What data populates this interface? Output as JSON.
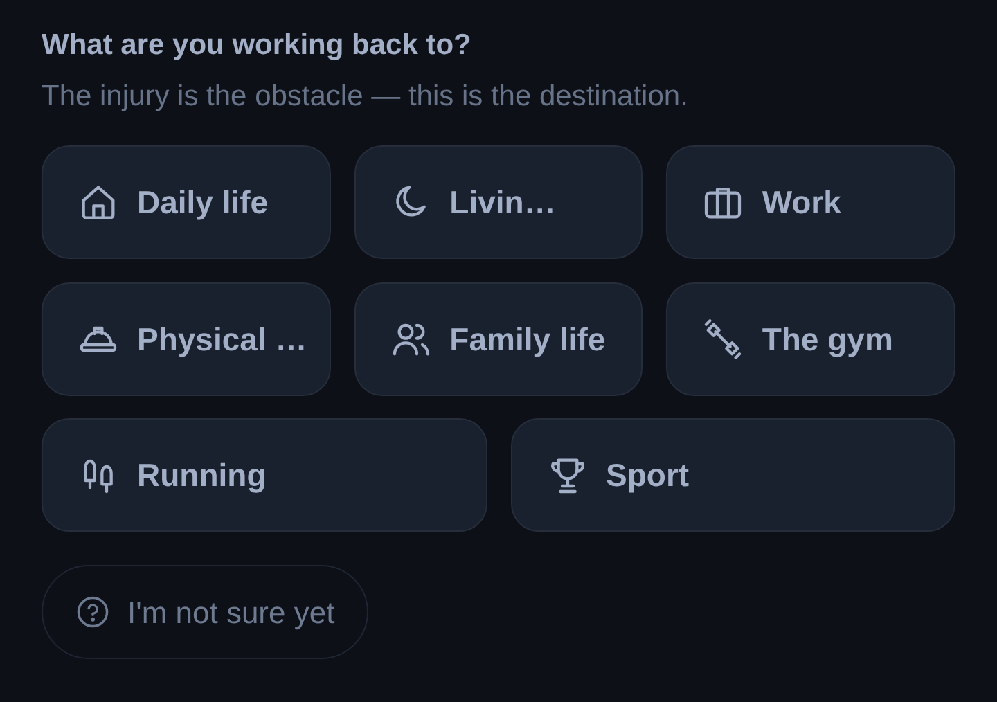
{
  "question": {
    "title": "What are you working back to?",
    "subtitle": "The injury is the obstacle — this is the destination."
  },
  "options": [
    {
      "label": "Daily life",
      "selected": false
    },
    {
      "label": "Livin…",
      "selected": false
    },
    {
      "label": "Work",
      "selected": false
    },
    {
      "label": "Physical …",
      "selected": false
    },
    {
      "label": "Family life",
      "selected": false
    },
    {
      "label": "The gym",
      "selected": false
    },
    {
      "label": "Running",
      "selected": false
    },
    {
      "label": "Sport",
      "selected": false
    }
  ],
  "unsure": {
    "label": "I'm not sure yet",
    "selected": false
  }
}
